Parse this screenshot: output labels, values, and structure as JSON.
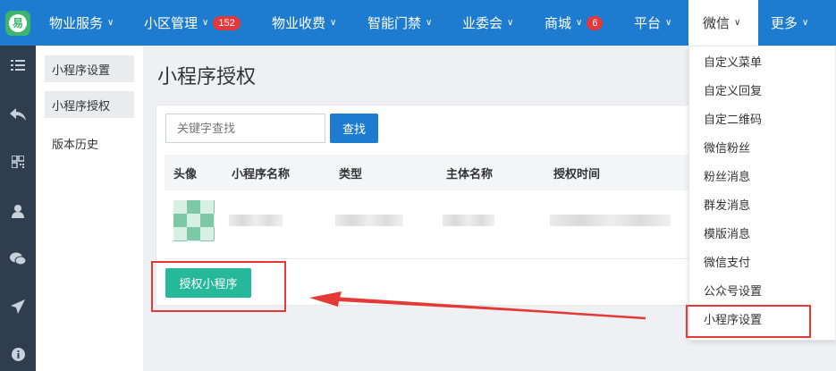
{
  "logo": {
    "char": "易"
  },
  "nav": {
    "items": [
      {
        "label": "物业服务"
      },
      {
        "label": "小区管理",
        "badge": "152"
      },
      {
        "label": "物业收费"
      },
      {
        "label": "智能门禁"
      },
      {
        "label": "业委会"
      },
      {
        "label": "商城",
        "badge": "6"
      },
      {
        "label": "平台"
      },
      {
        "label": "微信"
      },
      {
        "label": "更多"
      }
    ]
  },
  "iconbar": {
    "icons": [
      "list-icon",
      "reply-icon",
      "qrcode-icon",
      "user-icon",
      "wechat-icon",
      "send-icon",
      "info-icon"
    ]
  },
  "submenu": {
    "items": [
      {
        "label": "小程序设置"
      },
      {
        "label": "小程序授权"
      },
      {
        "label": "版本历史"
      }
    ]
  },
  "page": {
    "title": "小程序授权"
  },
  "search": {
    "placeholder": "关键字查找",
    "button": "查找"
  },
  "table": {
    "headers": [
      "头像",
      "小程序名称",
      "类型",
      "主体名称",
      "授权时间"
    ]
  },
  "actions": {
    "authorize_button": "授权小程序"
  },
  "wechat_menu": {
    "items": [
      "自定义菜单",
      "自定义回复",
      "自定二维码",
      "微信粉丝",
      "粉丝消息",
      "群发消息",
      "模版消息",
      "微信支付",
      "公众号设置",
      "小程序设置"
    ]
  },
  "colors": {
    "nav": "#1d7ccf",
    "sidebar": "#2e3e4e",
    "primary_button": "#1d7ccf",
    "success_button": "#26b89b",
    "badge": "#e4393c",
    "annotation": "#e53935"
  }
}
